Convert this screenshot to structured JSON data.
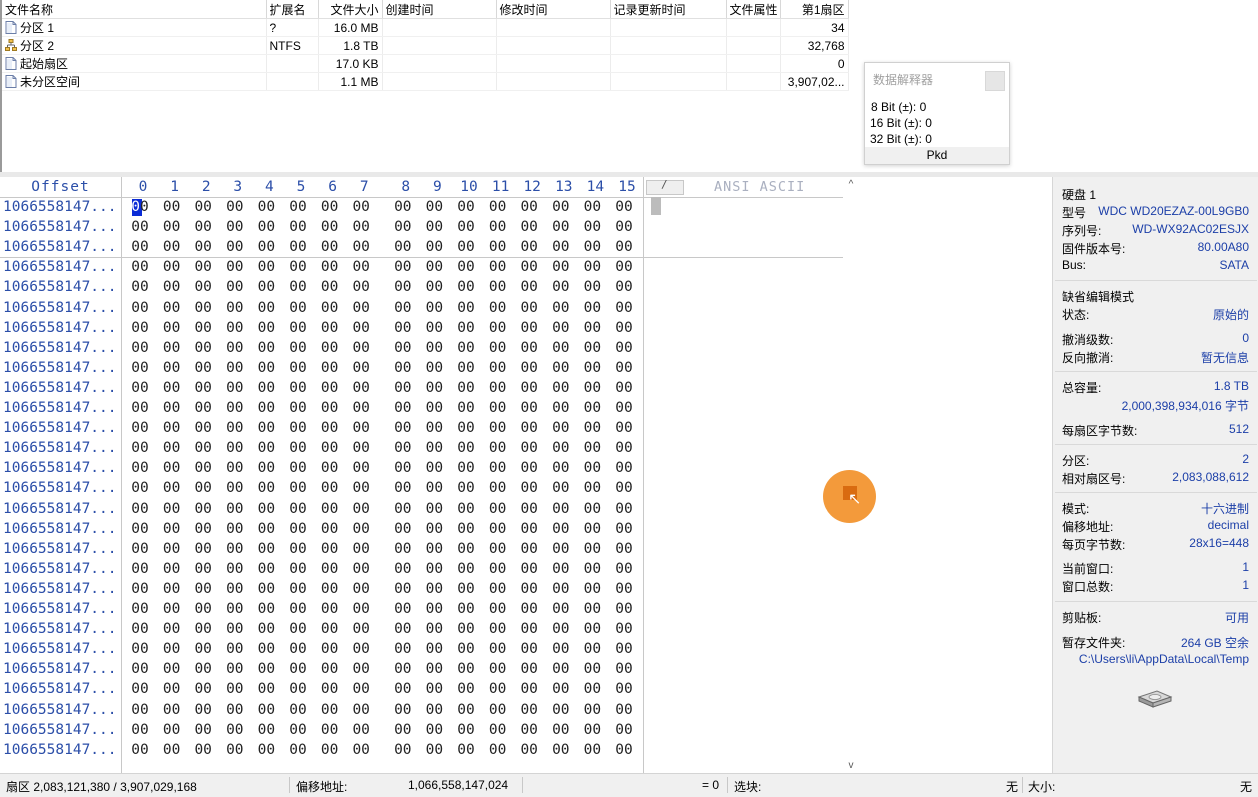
{
  "partition_table": {
    "headers": [
      "文件名称",
      "扩展名",
      "文件大小",
      "创建时间",
      "修改时间",
      "记录更新时间",
      "文件属性",
      "第1扇区"
    ],
    "rows": [
      {
        "name": "分区 1",
        "ext": "?",
        "size": "16.0 MB",
        "created": "",
        "modified": "",
        "updated": "",
        "attr": "",
        "first_sector": "34",
        "icon": "file-icon"
      },
      {
        "name": "分区 2",
        "ext": "NTFS",
        "size": "1.8 TB",
        "created": "",
        "modified": "",
        "updated": "",
        "attr": "",
        "first_sector": "32,768",
        "icon": "partition-tree-icon"
      },
      {
        "name": "起始扇区",
        "ext": "",
        "size": "17.0 KB",
        "created": "",
        "modified": "",
        "updated": "",
        "attr": "",
        "first_sector": "0",
        "icon": "file-icon"
      },
      {
        "name": "未分区空间",
        "ext": "",
        "size": "1.1 MB",
        "created": "",
        "modified": "",
        "updated": "",
        "attr": "",
        "first_sector": "3,907,02...",
        "icon": "file-icon"
      }
    ]
  },
  "data_interpreter": {
    "title": "数据解释器",
    "rows": [
      "8 Bit (±): 0",
      "16 Bit (±): 0",
      "32 Bit (±): 0"
    ],
    "footer": "Pkd"
  },
  "hex_editor": {
    "offset_header": "Offset",
    "columns": [
      "0",
      "1",
      "2",
      "3",
      "4",
      "5",
      "6",
      "7",
      "8",
      "9",
      "10",
      "11",
      "12",
      "13",
      "14",
      "15"
    ],
    "ascii_header": "ANSI ASCII",
    "ascii_button": "/",
    "offset_label": "1066558147...",
    "byte_value": "00",
    "row_count": 28,
    "selected_byte_row": 0,
    "selected_byte_col": 0,
    "highlight_color": "#0a2bd6"
  },
  "scrollbar": {
    "up_arrow": "^",
    "down_arrow": "v"
  },
  "info_panel": {
    "disk_title": "硬盘 1",
    "model_label": "型号",
    "model_value": "WDC WD20EZAZ-00L9GB0",
    "serial_label": "序列号:",
    "serial_value": "WD-WX92AC02ESJX",
    "firmware_label": "固件版本号:",
    "firmware_value": "80.00A80",
    "bus_label": "Bus:",
    "bus_value": "SATA",
    "edit_mode_title": "缺省编辑模式",
    "state_label": "状态:",
    "state_value": "原始的",
    "undo_label": "撤消级数:",
    "undo_value": "0",
    "reverse_undo_label": "反向撤消:",
    "reverse_undo_value": "暂无信息",
    "capacity_label": "总容量:",
    "capacity_value": "1.8 TB",
    "capacity_bytes": "2,000,398,934,016 字节",
    "bytes_per_sector_label": "每扇区字节数:",
    "bytes_per_sector_value": "512",
    "partition_label": "分区:",
    "partition_value": "2",
    "relative_sector_label": "相对扇区号:",
    "relative_sector_value": "2,083,088,612",
    "mode_label": "模式:",
    "mode_value": "十六进制",
    "offset_addr_label": "偏移地址:",
    "offset_addr_value": "decimal",
    "bytes_per_page_label": "每页字节数:",
    "bytes_per_page_value": "28x16=448",
    "current_window_label": "当前窗口:",
    "current_window_value": "1",
    "window_total_label": "窗口总数:",
    "window_total_value": "1",
    "clipboard_label": "剪贴板:",
    "clipboard_value": "可用",
    "temp_label": "暂存文件夹:",
    "temp_value": "264 GB 空余",
    "temp_path": "C:\\Users\\li\\AppData\\Local\\Temp"
  },
  "status_bar": {
    "sector": "扇区 2,083,121,380 / 3,907,029,168",
    "offset_label": "偏移地址:",
    "offset_value": "1,066,558,147,024",
    "eq_value": "= 0",
    "block_label": "选块:",
    "block_value": "无",
    "size_label": "大小:",
    "size_value": "无"
  },
  "colors": {
    "offset_text": "#2b4ea8",
    "info_value_blue": "#1c3fa8",
    "cursor_highlight": "#f39a3b"
  }
}
